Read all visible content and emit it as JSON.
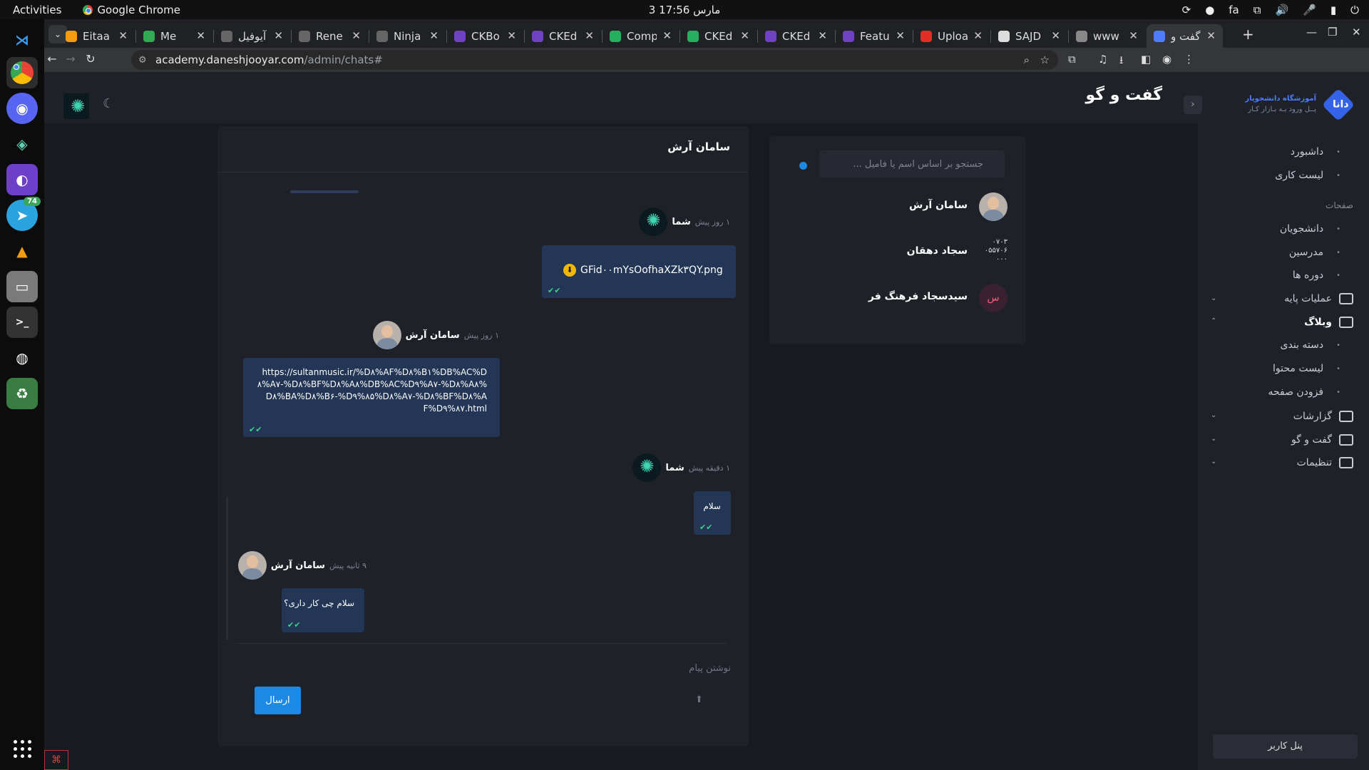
{
  "topbar": {
    "activities": "Activities",
    "app_name": "Google Chrome",
    "clock": "3 مارس  17:56",
    "lang": "fa"
  },
  "dock": {
    "telegram_badge": "74"
  },
  "tabs": [
    {
      "label": "Eitaa",
      "color": "#f39c12"
    },
    {
      "label": "Me",
      "color": "#34a853"
    },
    {
      "label": "آیوفیل",
      "color": "#666666"
    },
    {
      "label": "Rene",
      "color": "#666666"
    },
    {
      "label": "Ninja",
      "color": "#666666"
    },
    {
      "label": "CKBo",
      "color": "#6f42c1"
    },
    {
      "label": "CKEd",
      "color": "#6f42c1"
    },
    {
      "label": "Comp",
      "color": "#27ae60"
    },
    {
      "label": "CKEd",
      "color": "#27ae60"
    },
    {
      "label": "CKEd",
      "color": "#6f42c1"
    },
    {
      "label": "Featu",
      "color": "#6f42c1"
    },
    {
      "label": "Uploa",
      "color": "#e52d27"
    },
    {
      "label": "SAJD",
      "color": "#dddddd"
    },
    {
      "label": "www",
      "color": "#888888"
    },
    {
      "label": "گفت و",
      "color": "#4f7cff"
    }
  ],
  "address": {
    "host": "academy.daneshjooyar.com",
    "path": "/admin/chats#"
  },
  "header": {
    "title": "گفت و گو",
    "brand_line1": "آموزشگاه دانشجویار",
    "brand_line2": "پــل ورود بـه بـازار کـار",
    "brand_mark": "دانا"
  },
  "sidebar": {
    "items": [
      {
        "label": "داشبورد"
      },
      {
        "label": "لیست کاری"
      }
    ],
    "section_pages": "صفحات",
    "pages": [
      {
        "label": "دانشجویان"
      },
      {
        "label": "مدرسین"
      },
      {
        "label": "دوره ها"
      }
    ],
    "groups": [
      {
        "label": "عملیات پایه"
      },
      {
        "label": "وبلاگ"
      }
    ],
    "blog_items": [
      {
        "label": "دسته بندی"
      },
      {
        "label": "لیست محتوا"
      },
      {
        "label": "فزودن صفحه"
      }
    ],
    "more_groups": [
      {
        "label": "گزارشات"
      },
      {
        "label": "گفت و گو"
      },
      {
        "label": "تنظیمات"
      }
    ],
    "panel_button": "پنل کاربر"
  },
  "contacts": {
    "search_placeholder": "جستجو بر اساس اسم یا فامیل ...",
    "list": [
      {
        "name": "سامان آرش"
      },
      {
        "name": "سجاد دهقان",
        "avatar_text": "۰۷۰۳ ۰۵۵۷۰۶ ۰۰۰"
      },
      {
        "name": "سیدسجاد فرهنگ فر",
        "avatar_text": "س"
      }
    ]
  },
  "chat": {
    "title": "سامان آرش",
    "messages": [
      {
        "sender": "شما",
        "time": "۱ روز پیش",
        "file": "GFid۰۰mYsOofhaXZk۳QY.png"
      },
      {
        "sender": "سامان آرش",
        "time": "۱ روز پیش",
        "text": "https://sultanmusic.ir/%D۸%AF%D۸%B۱%DB%AC%D۸%A۷-%D۸%BF%D۸%A۸%DB%AC%D۹%A۷-%D۸%A۸%D۸%BA%D۸%B۶-%D۹%۸۵%D۸%A۷-%D۸%BF%D۸%AF%D۹%۸۷.html"
      },
      {
        "sender": "شما",
        "time": "۱ دقیقه پیش",
        "text": "سلام"
      },
      {
        "sender": "سامان آرش",
        "time": "۹ ثانیه پیش",
        "text": "سلام چی کار داری؟"
      }
    ],
    "compose_placeholder": "نوشتن پیام",
    "send_label": "ارسال"
  }
}
